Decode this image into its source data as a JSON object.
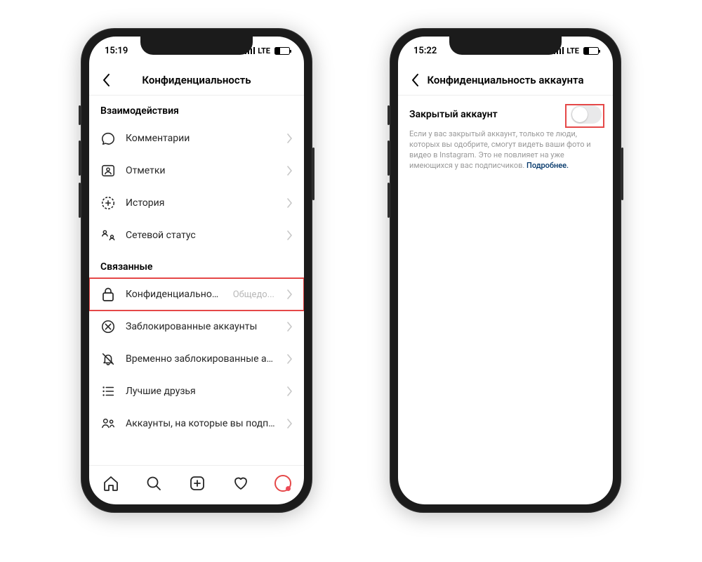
{
  "phone1": {
    "status": {
      "time": "15:19",
      "carrier": "LTE"
    },
    "nav": {
      "title": "Конфиденциальность"
    },
    "sections": {
      "interactions": {
        "header": "Взаимодействия",
        "items": {
          "comments": "Комментарии",
          "tags": "Отметки",
          "story": "История",
          "activity": "Сетевой статус"
        }
      },
      "connections": {
        "header": "Связанные",
        "items": {
          "acct_privacy": "Конфиденциальность аккаунта",
          "acct_privacy_val": "Общедо...",
          "blocked": "Заблокированные аккаунты",
          "muted": "Временно заблокированные аккаунты",
          "close_friends": "Лучшие друзья",
          "following": "Аккаунты, на которые вы подписаны"
        }
      }
    }
  },
  "phone2": {
    "status": {
      "time": "15:22",
      "carrier": "LTE"
    },
    "nav": {
      "title": "Конфиденциальность аккаунта"
    },
    "privacy": {
      "toggle_label": "Закрытый аккаунт",
      "description": "Если у вас закрытый аккаунт, только те люди, которых вы одобрите, смогут видеть ваши фото и видео в Instagram. Это не повлияет на уже имеющихся у вас подписчиков. ",
      "link": "Подробнее."
    }
  }
}
